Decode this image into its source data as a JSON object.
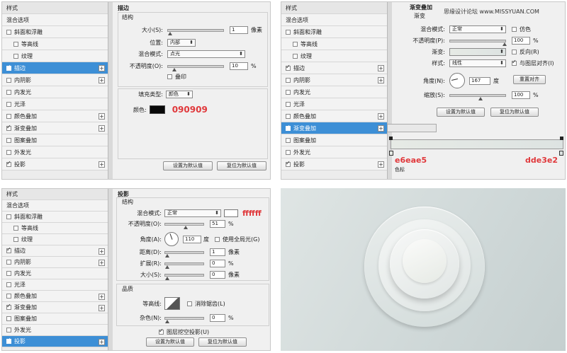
{
  "watermark": "思缘设计论坛 www.MISSYUAN.COM",
  "sidebar": {
    "styles_label": "样式",
    "blend_label": "混合选项",
    "items": [
      "斜面和浮雕",
      "等高线",
      "纹理",
      "描边",
      "内阴影",
      "内发光",
      "光泽",
      "颜色叠加",
      "渐变叠加",
      "图案叠加",
      "外发光",
      "投影"
    ]
  },
  "stroke": {
    "title": "描边",
    "group": "结构",
    "size_label": "大小(S):",
    "size_value": "1",
    "size_unit": "像素",
    "position_label": "位置:",
    "position_value": "内部",
    "blend_label": "混合模式:",
    "blend_value": "点光",
    "opacity_label": "不透明度(O):",
    "opacity_value": "10",
    "opacity_unit": "%",
    "overprint_label": "叠印",
    "fill_type_label": "填充类型:",
    "fill_type_value": "颜色",
    "color_label": "颜色:",
    "color_hex": "#090909",
    "color_annotation": "090909",
    "default_btn": "设置为默认值",
    "reset_btn": "复位为默认值"
  },
  "gradient": {
    "title": "渐变叠加",
    "group": "渐变",
    "blend_label": "混合模式:",
    "blend_value": "正常",
    "dither_label": "仿色",
    "opacity_label": "不透明度(P):",
    "opacity_value": "100",
    "opacity_unit": "%",
    "gradient_label": "渐变:",
    "reverse_label": "反向(R)",
    "style_label": "样式:",
    "style_value": "线性",
    "align_label": "与图层对齐(I)",
    "angle_label": "角度(N):",
    "angle_value": "167",
    "angle_unit": "度",
    "reset_align_btn": "重置对齐",
    "scale_label": "缩放(S):",
    "scale_value": "100",
    "scale_unit": "%",
    "default_btn": "设置为默认值",
    "reset_btn": "复位为默认值",
    "stop_left": "e6eae5",
    "stop_right": "dde3e2",
    "color_stop_label": "色标",
    "color_left": "#e6eae5",
    "color_right": "#dde3e2"
  },
  "shadow": {
    "title": "投影",
    "group": "结构",
    "blend_label": "混合模式:",
    "blend_value": "正常",
    "color_annotation": "ffffff",
    "opacity_label": "不透明度(O):",
    "opacity_value": "51",
    "opacity_unit": "%",
    "angle_label": "角度(A):",
    "angle_value": "110",
    "angle_unit": "度",
    "global_light_label": "使用全局光(G)",
    "distance_label": "距离(D):",
    "distance_value": "1",
    "distance_unit": "像素",
    "spread_label": "扩展(R):",
    "spread_value": "0",
    "spread_unit": "%",
    "size_label": "大小(S):",
    "size_value": "0",
    "size_unit": "像素",
    "quality_group": "品质",
    "contour_label": "等高线:",
    "antialias_label": "消除锯齿(L)",
    "noise_label": "杂色(N):",
    "noise_value": "0",
    "noise_unit": "%",
    "knockout_label": "图层挖空投影(U)",
    "default_btn": "设置为默认值",
    "reset_btn": "复位为默认值"
  }
}
